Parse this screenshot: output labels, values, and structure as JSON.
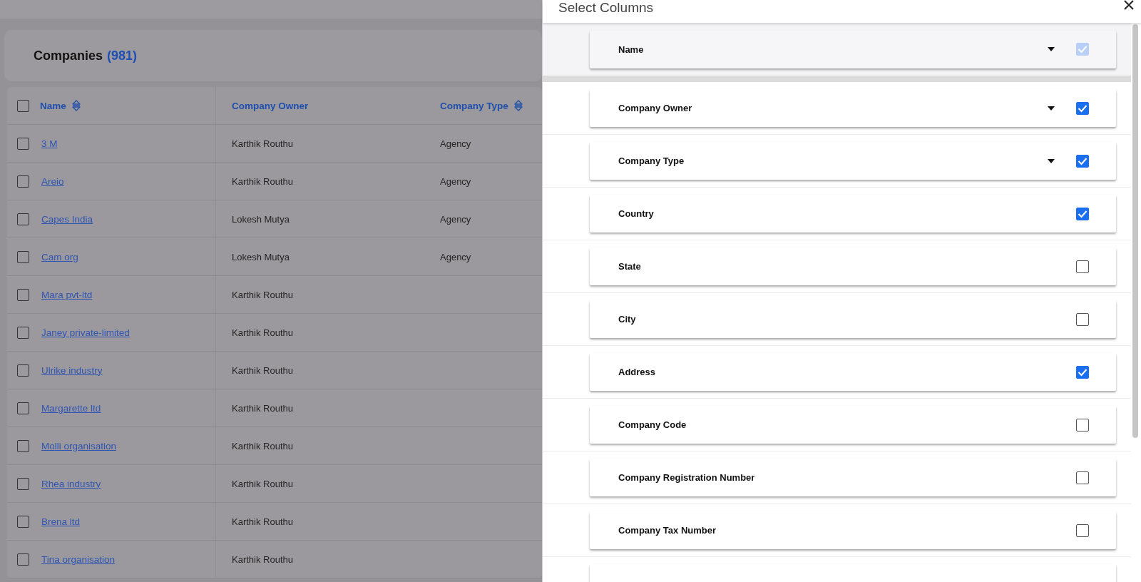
{
  "page": {
    "title": "Companies",
    "count": "(981)"
  },
  "table": {
    "all_selected": false,
    "columns": [
      {
        "label": "Name",
        "sortable": true
      },
      {
        "label": "Company Owner",
        "sortable": false
      },
      {
        "label": "Company Type",
        "sortable": true
      }
    ],
    "rows": [
      {
        "name": "3 M",
        "owner": "Karthik Routhu",
        "type": "Agency",
        "selected": false
      },
      {
        "name": "Areio",
        "owner": "Karthik Routhu",
        "type": "Agency",
        "selected": false
      },
      {
        "name": "Capes India",
        "owner": "Lokesh Mutya",
        "type": "Agency",
        "selected": false
      },
      {
        "name": "Cam org",
        "owner": "Lokesh Mutya",
        "type": "Agency",
        "selected": false
      },
      {
        "name": "Mara pvt-ltd",
        "owner": "Karthik Routhu",
        "selected": false
      },
      {
        "name": "Janey private-limited",
        "owner": "Karthik Routhu",
        "selected": false
      },
      {
        "name": "Ulrike industry",
        "owner": "Karthik Routhu",
        "selected": false
      },
      {
        "name": "Margarette ltd",
        "owner": "Karthik Routhu",
        "selected": false
      },
      {
        "name": "Molli organisation",
        "owner": "Karthik Routhu",
        "selected": false
      },
      {
        "name": "Rhea industry",
        "owner": "Karthik Routhu",
        "selected": false
      },
      {
        "name": "Brena ltd",
        "owner": "Karthik Routhu",
        "selected": false
      },
      {
        "name": "Tina organisation",
        "owner": "Karthik Routhu",
        "selected": false
      }
    ]
  },
  "panel": {
    "title": "Select Columns",
    "columns": [
      {
        "label": "Name",
        "checked": true,
        "disabled": true,
        "menu": true
      },
      {
        "label": "Company Owner",
        "checked": true,
        "disabled": false,
        "menu": true
      },
      {
        "label": "Company Type",
        "checked": true,
        "disabled": false,
        "menu": true
      },
      {
        "label": "Country",
        "checked": true,
        "disabled": false,
        "menu": false
      },
      {
        "label": "State",
        "checked": false,
        "disabled": false,
        "menu": false
      },
      {
        "label": "City",
        "checked": false,
        "disabled": false,
        "menu": false
      },
      {
        "label": "Address",
        "checked": true,
        "disabled": false,
        "menu": false
      },
      {
        "label": "Company Code",
        "checked": false,
        "disabled": false,
        "menu": false
      },
      {
        "label": "Company Registration Number",
        "checked": false,
        "disabled": false,
        "menu": false
      },
      {
        "label": "Company Tax Number",
        "checked": false,
        "disabled": false,
        "menu": false
      }
    ]
  }
}
